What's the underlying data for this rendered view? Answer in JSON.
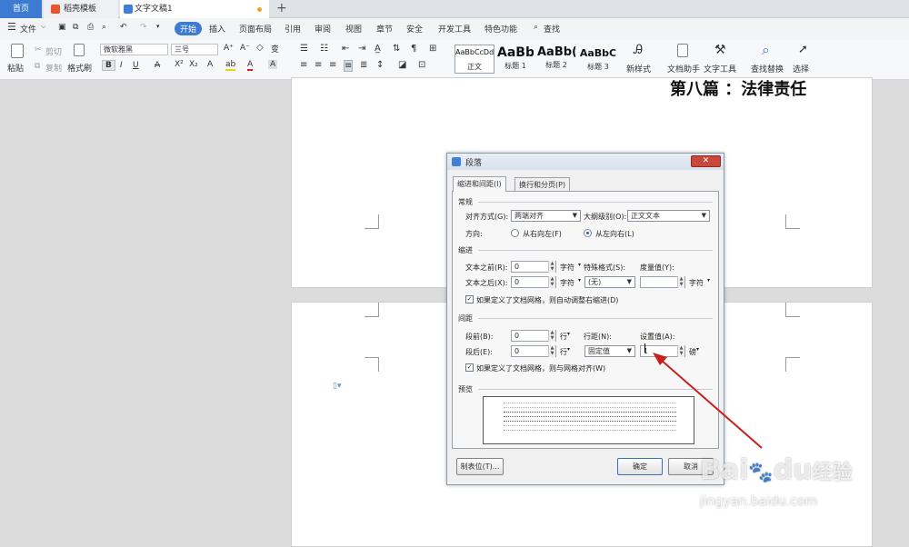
{
  "tabs": {
    "home": "首页",
    "wps": "稻壳模板",
    "doc": "文字文稿1",
    "new_icon": "plus-icon"
  },
  "menu": {
    "file": "文件",
    "items": [
      "开始",
      "插入",
      "页面布局",
      "引用",
      "审阅",
      "视图",
      "章节",
      "安全",
      "开发工具",
      "特色功能"
    ],
    "search": "查找"
  },
  "toolbar": {
    "paste": "粘贴",
    "cut": "剪切",
    "copy": "复制",
    "format_painter": "格式刷",
    "font_name": "微软雅黑",
    "font_size": "三号",
    "styles": [
      {
        "preview": "AaBbCcDd",
        "caption": "正文"
      },
      {
        "preview": "AaBb",
        "caption": "标题 1"
      },
      {
        "preview": "AaBb(",
        "caption": "标题 2"
      },
      {
        "preview": "AaBbC",
        "caption": "标题 3"
      }
    ],
    "new_style": "新样式",
    "doc_assistant": "文档助手",
    "text_tools": "文字工具",
    "find_replace": "查找替换",
    "select": "选择"
  },
  "document": {
    "heading": "第八篇  ：法律责任"
  },
  "dialog": {
    "title": "段落",
    "tab_indent": "缩进和间距(I)",
    "tab_breaks": "换行和分页(P)",
    "general": {
      "section": "常规",
      "align_label": "对齐方式(G):",
      "align_value": "两端对齐",
      "outline_label": "大纲级别(O):",
      "outline_value": "正文文本",
      "dir_label": "方向:",
      "rtl": "从右向左(F)",
      "ltr": "从左向右(L)"
    },
    "indent": {
      "section": "缩进",
      "before_label": "文本之前(R):",
      "before_value": "0",
      "before_unit": "字符",
      "after_label": "文本之后(X):",
      "after_value": "0",
      "after_unit": "字符",
      "special_label": "特殊格式(S):",
      "special_value": "(无)",
      "measure_label": "度量值(Y):",
      "measure_unit": "字符",
      "grid_check": "如果定义了文档网格，则自动调整右缩进(D)"
    },
    "spacing": {
      "section": "间距",
      "before_label": "段前(B):",
      "before_value": "0",
      "before_unit": "行",
      "after_label": "段后(E):",
      "after_value": "0",
      "after_unit": "行",
      "line_label": "行距(N):",
      "line_value": "固定值",
      "set_label": "设置值(A):",
      "set_value": "1",
      "set_unit": "磅",
      "grid_check": "如果定义了文档网格，则与网格对齐(W)"
    },
    "preview_label": "预览",
    "tabs_button": "制表位(T)...",
    "ok": "确定",
    "cancel": "取消"
  },
  "watermark": {
    "brand": "Bai",
    "brand2": "du",
    "brand_cn": "经验",
    "url": "jingyan.baidu.com"
  },
  "colors": {
    "accent": "#3c7bd1",
    "arrow": "#c8201c"
  }
}
